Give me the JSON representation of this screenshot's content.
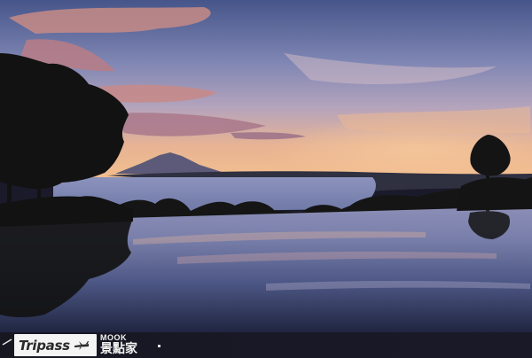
{
  "scene": {
    "description_tags": [
      "sunset-sky",
      "mountain-silhouette",
      "bay",
      "infinity-pool-reflection",
      "tree-silhouettes"
    ],
    "colors": {
      "sky_top": "#4d5a8e",
      "sky_mid": "#8a8fb8",
      "sky_warm": "#e0a889",
      "cloud_pink": "#c98a8a",
      "horizon_glow": "#f0b58a",
      "water": "#6f7ba8",
      "pool_dark": "#2a3050",
      "silhouette": "#141414"
    }
  },
  "watermark": {
    "brand": "Tripass",
    "brand_color": "#2a2a2a",
    "publisher_top": "MOOK",
    "publisher_bottom": "景點家"
  }
}
